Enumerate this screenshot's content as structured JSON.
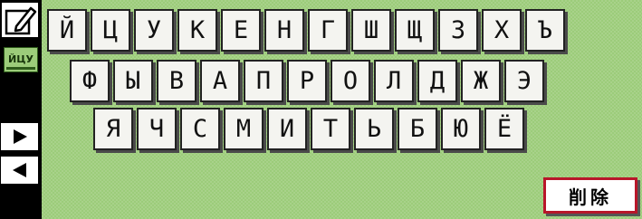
{
  "sidebar": {
    "edit_icon": "pencil-square-icon",
    "mode_label": "ЙЦУ",
    "next_icon": "triangle-right-icon",
    "prev_icon": "triangle-left-icon"
  },
  "keyboard": {
    "row1": [
      "Й",
      "Ц",
      "У",
      "К",
      "Е",
      "Н",
      "Г",
      "Ш",
      "Щ",
      "З",
      "Х",
      "Ъ"
    ],
    "row2": [
      "Ф",
      "Ы",
      "В",
      "А",
      "П",
      "Р",
      "О",
      "Л",
      "Д",
      "Ж",
      "Э"
    ],
    "row3": [
      "Я",
      "Ч",
      "С",
      "М",
      "И",
      "Т",
      "Ь",
      "Б",
      "Ю",
      "Ё"
    ]
  },
  "delete_label": "削除",
  "colors": {
    "background": "#9ccc7a",
    "sidebar": "#000000",
    "delete_border": "#b8162a"
  }
}
